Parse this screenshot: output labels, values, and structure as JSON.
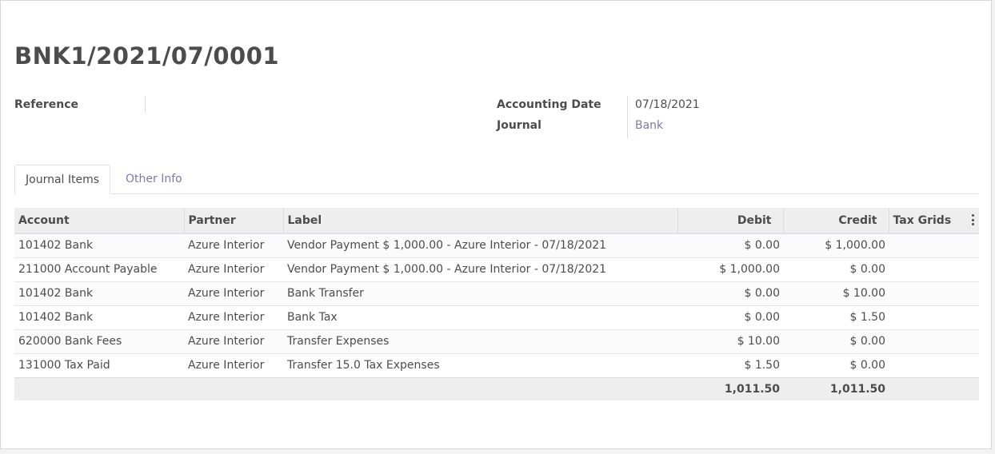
{
  "move": {
    "title": "BNK1/2021/07/0001",
    "reference_label": "Reference",
    "reference_value": "",
    "accounting_date_label": "Accounting Date",
    "accounting_date_value": "07/18/2021",
    "journal_label": "Journal",
    "journal_value": "Bank"
  },
  "tabs": [
    {
      "label": "Journal Items",
      "active": true
    },
    {
      "label": "Other Info",
      "active": false
    }
  ],
  "table": {
    "columns": [
      "Account",
      "Partner",
      "Label",
      "Debit",
      "Credit",
      "Tax Grids"
    ],
    "rows": [
      {
        "account": "101402 Bank",
        "partner": "Azure Interior",
        "label": "Vendor Payment $ 1,000.00 - Azure Interior - 07/18/2021",
        "debit": "$ 0.00",
        "credit": "$ 1,000.00",
        "tax_grids": ""
      },
      {
        "account": "211000 Account Payable",
        "partner": "Azure Interior",
        "label": "Vendor Payment $ 1,000.00 - Azure Interior - 07/18/2021",
        "debit": "$ 1,000.00",
        "credit": "$ 0.00",
        "tax_grids": ""
      },
      {
        "account": "101402 Bank",
        "partner": "Azure Interior",
        "label": "Bank Transfer",
        "debit": "$ 0.00",
        "credit": "$ 10.00",
        "tax_grids": ""
      },
      {
        "account": "101402 Bank",
        "partner": "Azure Interior",
        "label": "Bank Tax",
        "debit": "$ 0.00",
        "credit": "$ 1.50",
        "tax_grids": ""
      },
      {
        "account": "620000 Bank Fees",
        "partner": "Azure Interior",
        "label": "Transfer Expenses",
        "debit": "$ 10.00",
        "credit": "$ 0.00",
        "tax_grids": ""
      },
      {
        "account": "131000 Tax Paid",
        "partner": "Azure Interior",
        "label": "Transfer 15.0 Tax Expenses",
        "debit": "$ 1.50",
        "credit": "$ 0.00",
        "tax_grids": ""
      }
    ],
    "totals": {
      "debit": "1,011.50",
      "credit": "1,011.50"
    },
    "optional_columns_icon": "kebab-vertical-icon"
  },
  "colors": {
    "link": "#7c7bad",
    "text": "#4c4c4c",
    "header_bg": "#eeeeee"
  }
}
